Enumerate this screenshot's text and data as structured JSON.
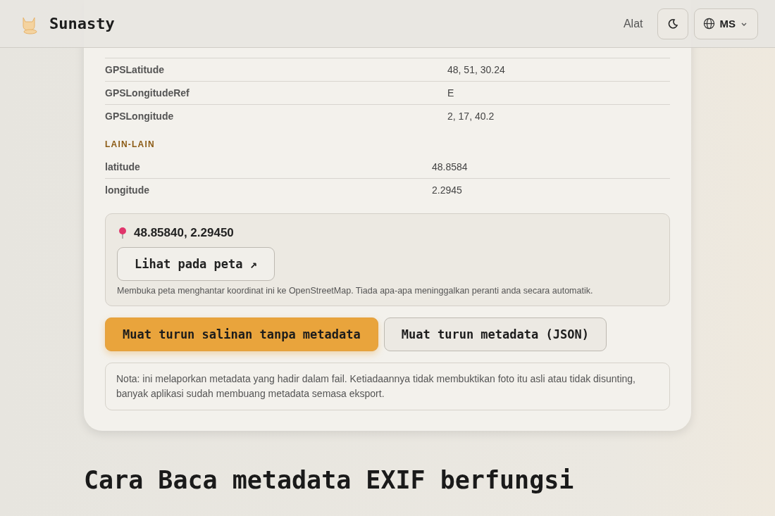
{
  "header": {
    "brand": "Sunasty",
    "nav_link": "Alat",
    "language": "MS"
  },
  "gps_rows": [
    {
      "key": "GPSLatitude",
      "value": "48, 51, 30.24"
    },
    {
      "key": "GPSLongitudeRef",
      "value": "E"
    },
    {
      "key": "GPSLongitude",
      "value": "2, 17, 40.2"
    }
  ],
  "other_section": {
    "title": "LAIN-LAIN",
    "rows": [
      {
        "key": "latitude",
        "value": "48.8584"
      },
      {
        "key": "longitude",
        "value": "2.2945"
      }
    ]
  },
  "location": {
    "coordinates": "48.85840, 2.29450",
    "map_button": "Lihat pada peta ↗",
    "note": "Membuka peta menghantar koordinat ini ke OpenStreetMap. Tiada apa-apa meninggalkan peranti anda secara automatik."
  },
  "actions": [
    {
      "label": "Muat turun salinan tanpa metadata",
      "kind": "primary"
    },
    {
      "label": "Muat turun metadata (JSON)",
      "kind": "secondary"
    }
  ],
  "disclaimer": "Nota: ini melaporkan metadata yang hadir dalam fail. Ketiadaannya tidak membuktikan foto itu asli atau tidak disunting, banyak aplikasi sudah membuang metadata semasa eksport.",
  "heading": "Cara Baca metadata EXIF berfungsi"
}
